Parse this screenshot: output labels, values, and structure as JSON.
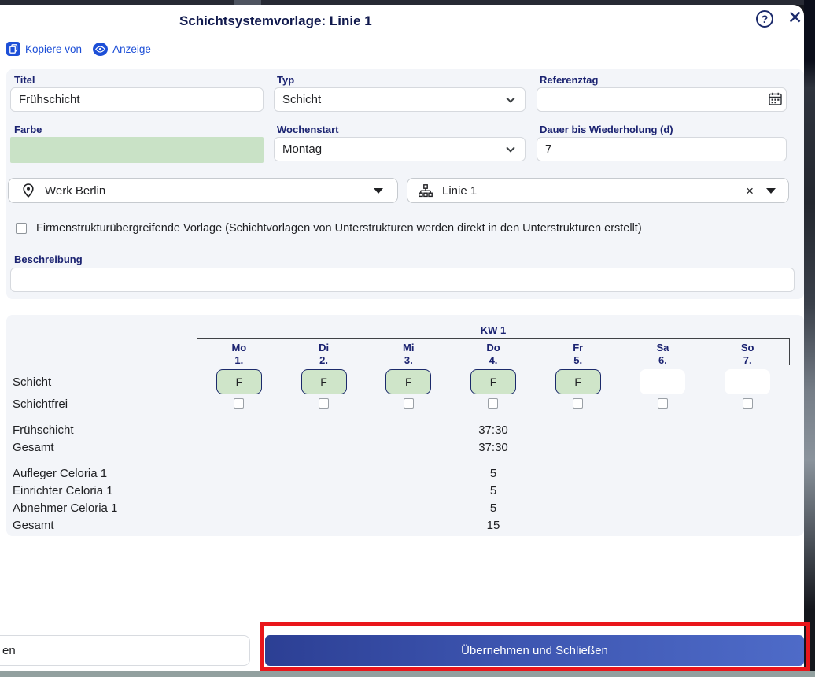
{
  "dialog": {
    "title": "Schichtsystemvorlage: Linie 1",
    "help_glyph": "?",
    "close_glyph": "✕"
  },
  "toolbar": {
    "copy_from_label": "Kopiere von",
    "display_label": "Anzeige"
  },
  "form": {
    "titel": {
      "label": "Titel",
      "value": "Frühschicht"
    },
    "typ": {
      "label": "Typ",
      "value": "Schicht"
    },
    "referenztag": {
      "label": "Referenztag",
      "value": ""
    },
    "farbe": {
      "label": "Farbe",
      "color": "#c9e2c6"
    },
    "wochenstart": {
      "label": "Wochenstart",
      "value": "Montag"
    },
    "dauer": {
      "label": "Dauer bis Wiederholung (d)",
      "value": "7"
    },
    "structure": {
      "value": "Werk Berlin"
    },
    "substructure": {
      "value": "Linie 1",
      "clear_glyph": "×"
    },
    "company_checkbox_label": "Firmenstrukturübergreifende Vorlage (Schichtvorlagen von Unterstrukturen werden direkt in den Unterstrukturen erstellt)",
    "beschreibung": {
      "label": "Beschreibung",
      "value": ""
    }
  },
  "schedule": {
    "week_label": "KW 1",
    "row_labels": {
      "schicht": "Schicht",
      "schichtfrei": "Schichtfrei"
    },
    "days": [
      {
        "name": "Mo",
        "date": "1.",
        "shift": "F"
      },
      {
        "name": "Di",
        "date": "2.",
        "shift": "F"
      },
      {
        "name": "Mi",
        "date": "3.",
        "shift": "F"
      },
      {
        "name": "Do",
        "date": "4.",
        "shift": "F"
      },
      {
        "name": "Fr",
        "date": "5.",
        "shift": "F"
      },
      {
        "name": "Sa",
        "date": "6.",
        "shift": ""
      },
      {
        "name": "So",
        "date": "7.",
        "shift": ""
      }
    ],
    "hours": [
      {
        "label": "Frühschicht",
        "value": "37:30"
      },
      {
        "label": "Gesamt",
        "value": "37:30"
      }
    ],
    "staffing": [
      {
        "label": "Aufleger Celoria 1",
        "value": "5"
      },
      {
        "label": "Einrichter Celoria 1",
        "value": "5"
      },
      {
        "label": "Abnehmer Celoria 1",
        "value": "5"
      },
      {
        "label": "Gesamt",
        "value": "15"
      }
    ]
  },
  "footer": {
    "left_button_fragment": "en",
    "primary_button_label": "Übernehmen und Schließen"
  },
  "colors": {
    "label_navy": "#1b2371",
    "title_navy": "#10194d",
    "link_blue": "#1d4fd7",
    "shift_green": "#cfe5c9",
    "primary_gradient_start": "#2c3f94",
    "primary_gradient_end": "#4e6bc8",
    "annotation_red": "#e9161b"
  }
}
